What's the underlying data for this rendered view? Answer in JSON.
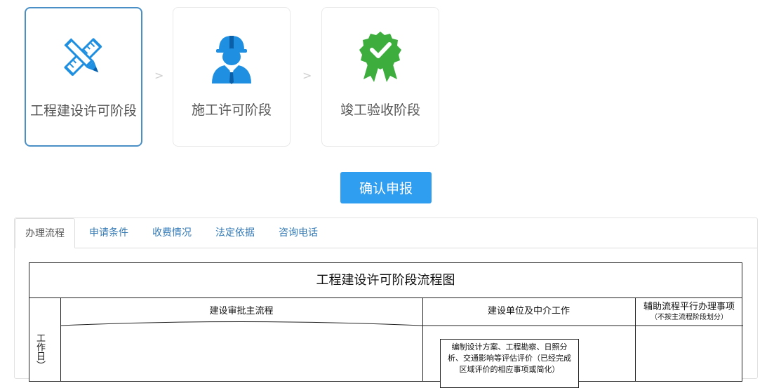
{
  "stages": [
    {
      "label": "工程建设许可阶段",
      "icon": "ruler-pencil-icon",
      "active": true
    },
    {
      "label": "施工许可阶段",
      "icon": "construction-worker-icon",
      "active": false
    },
    {
      "label": "竣工验收阶段",
      "icon": "award-badge-icon",
      "active": false
    }
  ],
  "separator": ">",
  "confirm_label": "确认申报",
  "tabs": [
    "办理流程",
    "申请条件",
    "收费情况",
    "法定依据",
    "咨询电话"
  ],
  "flowchart": {
    "title": "工程建设许可阶段流程图",
    "columns": {
      "main": "建设审批主流程",
      "unit": "建设单位及中介工作",
      "aux": "辅助流程平行办理事项",
      "aux_note": "（不按主流程阶段划分）"
    },
    "side_label": "工作日）",
    "box_text": "编制设计方案、工程勘察、日照分析、交通影响等评估评价（已经完成区域评价的相应事项或简化）"
  },
  "colors": {
    "accent": "#2f9df0",
    "active_border": "#4a90c6",
    "tab_link": "#337ab7",
    "icon_blue": "#1e8fe1",
    "icon_green": "#3dae3d"
  }
}
